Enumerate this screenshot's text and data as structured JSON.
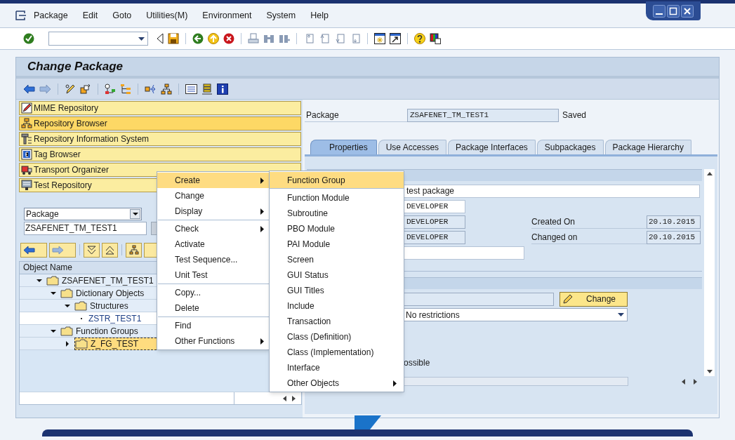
{
  "menu_bar": [
    "Package",
    "Edit",
    "Goto",
    "Utilities(M)",
    "Environment",
    "System",
    "Help"
  ],
  "screen_title": "Change Package",
  "navigation_buttons": [
    {
      "label": "MIME Repository",
      "selected": false
    },
    {
      "label": "Repository Browser",
      "selected": true
    },
    {
      "label": "Repository Information System",
      "selected": false
    },
    {
      "label": "Tag Browser",
      "selected": false
    },
    {
      "label": "Transport Organizer",
      "selected": false
    },
    {
      "label": "Test Repository",
      "selected": false
    }
  ],
  "object_selector": {
    "type": "Package",
    "name": "ZSAFENET_TM_TEST1"
  },
  "tree": {
    "column_1": "Object Name",
    "nodes": [
      {
        "label": "ZSAFENET_TM_TEST1",
        "kind": "folder",
        "expanded": true,
        "selected": false,
        "children": [
          {
            "label": "Dictionary Objects",
            "kind": "folder",
            "expanded": true,
            "selected": false,
            "children": [
              {
                "label": "Structures",
                "kind": "folder",
                "expanded": true,
                "selected": false,
                "children": [
                  {
                    "label": "ZSTR_TEST1",
                    "kind": "object",
                    "selected": false
                  }
                ]
              }
            ]
          },
          {
            "label": "Function Groups",
            "kind": "folder",
            "expanded": true,
            "selected": false,
            "children": [
              {
                "label": "Z_FG_TEST",
                "kind": "folder",
                "expanded": false,
                "selected": true
              }
            ]
          }
        ]
      }
    ]
  },
  "context_menu": {
    "groups": [
      [
        {
          "label": "Create",
          "submenu": true,
          "selected": true
        },
        {
          "label": "Change",
          "submenu": false,
          "selected": false
        },
        {
          "label": "Display",
          "submenu": true,
          "selected": false
        }
      ],
      [
        {
          "label": "Check",
          "submenu": true,
          "selected": false
        },
        {
          "label": "Activate",
          "submenu": false,
          "selected": false
        },
        {
          "label": "Test Sequence...",
          "submenu": false,
          "selected": false
        },
        {
          "label": "Unit Test",
          "submenu": false,
          "selected": false
        }
      ],
      [
        {
          "label": "Copy...",
          "submenu": false,
          "selected": false
        },
        {
          "label": "Delete",
          "submenu": false,
          "selected": false
        }
      ],
      [
        {
          "label": "Find",
          "submenu": false,
          "selected": false
        },
        {
          "label": "Other Functions",
          "submenu": true,
          "selected": false
        }
      ]
    ]
  },
  "submenu": {
    "items": [
      {
        "label": "Function Group",
        "submenu": false,
        "selected": true
      },
      {
        "label": "Function Module",
        "submenu": false,
        "selected": false
      },
      {
        "label": "Subroutine",
        "submenu": false,
        "selected": false
      },
      {
        "label": "PBO Module",
        "submenu": false,
        "selected": false
      },
      {
        "label": "PAI Module",
        "submenu": false,
        "selected": false
      },
      {
        "label": "Screen",
        "submenu": false,
        "selected": false
      },
      {
        "label": "GUI Status",
        "submenu": false,
        "selected": false
      },
      {
        "label": "GUI Titles",
        "submenu": false,
        "selected": false
      },
      {
        "label": "Include",
        "submenu": false,
        "selected": false
      },
      {
        "label": "Transaction",
        "submenu": false,
        "selected": false
      },
      {
        "label": "Class (Definition)",
        "submenu": false,
        "selected": false
      },
      {
        "label": "Class (Implementation)",
        "submenu": false,
        "selected": false
      },
      {
        "label": "Interface",
        "submenu": false,
        "selected": false
      },
      {
        "label": "Other Objects",
        "submenu": true,
        "selected": false
      }
    ]
  },
  "header": {
    "package_label": "Package",
    "package_value": "ZSAFENET_TM_TEST1",
    "status": "Saved"
  },
  "tabs": [
    {
      "label": "Properties",
      "selected": true
    },
    {
      "label": "Use Accesses",
      "selected": false
    },
    {
      "label": "Package Interfaces",
      "selected": false
    },
    {
      "label": "Subpackages",
      "selected": false
    },
    {
      "label": "Package Hierarchy",
      "selected": false
    }
  ],
  "properties": {
    "description": "test package",
    "users": [
      {
        "value": "DEVELOPER",
        "editable": true
      },
      {
        "value": "DEVELOPER",
        "editable": false
      },
      {
        "value": "DEVELOPER",
        "editable": false
      }
    ],
    "created_on": {
      "label": "Created On",
      "value": "20.10.2015"
    },
    "changed_on": {
      "label": "Changed on",
      "value": "20.10.2015"
    },
    "change_button": "Change",
    "restriction": "No restrictions",
    "fragment": "ossible"
  }
}
